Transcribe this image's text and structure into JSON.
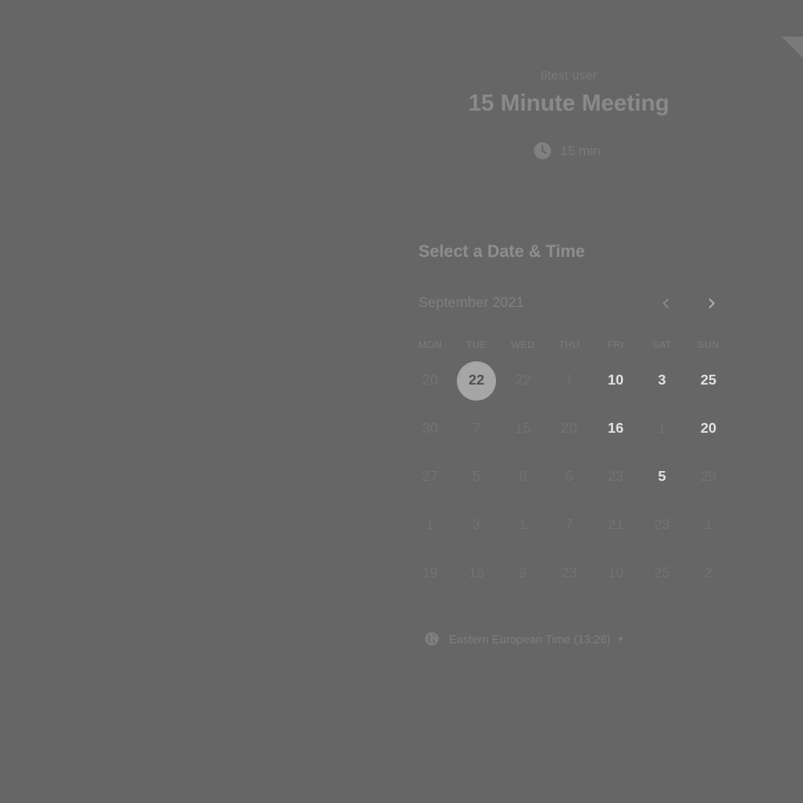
{
  "event": {
    "host": "6test user",
    "title": "15 Minute Meeting",
    "duration": "15 min"
  },
  "scheduler": {
    "heading": "Select a Date & Time",
    "month": "September 2021",
    "weekdays": [
      "MON",
      "TUE",
      "WED",
      "THU",
      "FRI",
      "SAT",
      "SUN"
    ],
    "rows": [
      [
        "20",
        "22",
        "22",
        "1",
        "10",
        "3",
        "25"
      ],
      [
        "30",
        "7",
        "15",
        "20",
        "16",
        "1",
        "20"
      ],
      [
        "27",
        "5",
        "8",
        "5",
        "23",
        "5",
        "29"
      ],
      [
        "1",
        "3",
        "1",
        "7",
        "21",
        "23",
        "1"
      ],
      [
        "19",
        "15",
        "9",
        "23",
        "10",
        "25",
        "2"
      ]
    ],
    "available": [
      [
        0,
        1
      ],
      [
        0,
        4
      ],
      [
        0,
        5
      ],
      [
        0,
        6
      ],
      [
        1,
        4
      ],
      [
        1,
        6
      ],
      [
        2,
        5
      ]
    ],
    "selected": [
      0,
      1
    ]
  },
  "timezone": {
    "label": "Eastern European Time (13:26)"
  },
  "icons": {
    "clock": "clock-icon",
    "globe": "globe-icon",
    "prev": "chevron-left-icon",
    "next": "chevron-right-icon",
    "caret": "caret-down-icon"
  }
}
